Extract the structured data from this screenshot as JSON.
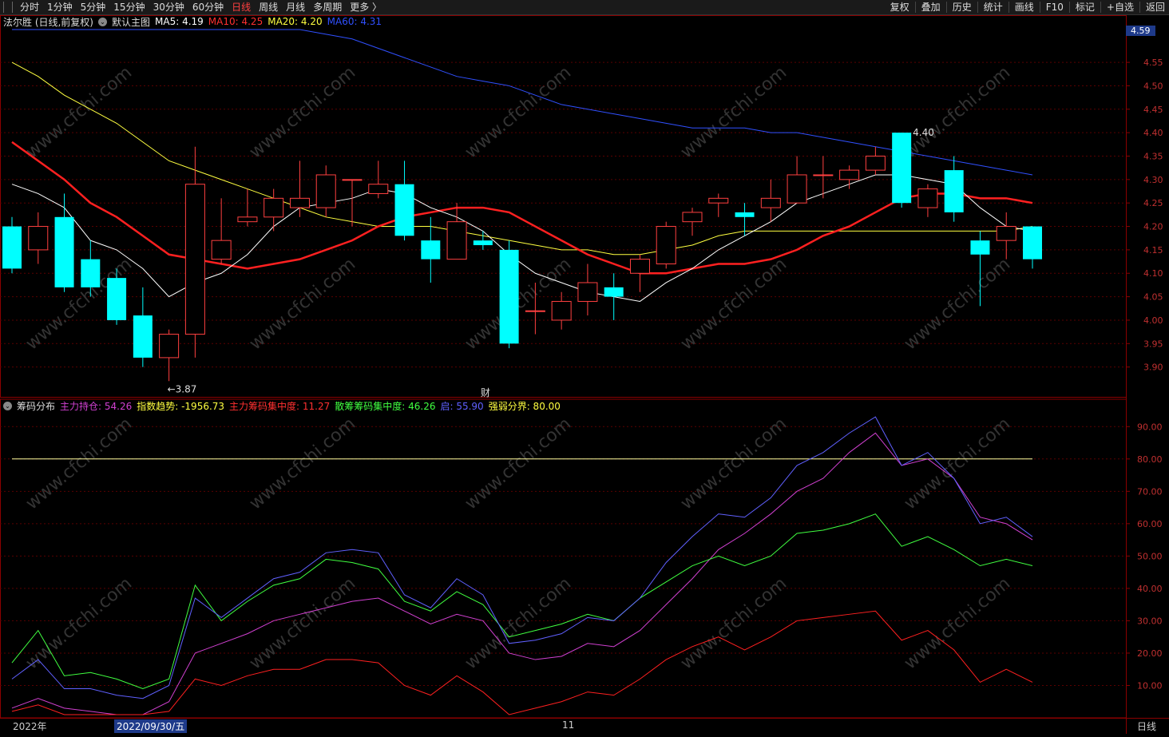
{
  "toolbar": {
    "left_items": [
      "分时",
      "1分钟",
      "5分钟",
      "15分钟",
      "30分钟",
      "60分钟",
      "日线",
      "周线",
      "月线",
      "多周期",
      "更多 〉"
    ],
    "active_item": "日线",
    "right_items": [
      "复权",
      "叠加",
      "历史",
      "统计",
      "画线",
      "F10",
      "标记",
      "+自选",
      "返回"
    ]
  },
  "main_legend": {
    "stock": "法尔胜 (日线,前复权)",
    "template": "默认主图",
    "ma5": "MA5: 4.19",
    "ma10": "MA10: 4.25",
    "ma20": "MA20: 4.20",
    "ma60": "MA60: 4.31",
    "colors": {
      "ma5": "#ffffff",
      "ma10": "#ff3030",
      "ma20": "#ffff40",
      "ma60": "#3050ff"
    }
  },
  "current_price_tag": "4.59",
  "price_axis": [
    "4.55",
    "4.50",
    "4.45",
    "4.40",
    "4.35",
    "4.30",
    "4.25",
    "4.20",
    "4.15",
    "4.10",
    "4.05",
    "4.00",
    "3.95",
    "3.90"
  ],
  "annotations": {
    "high": "4.40",
    "low": "←3.87",
    "marker": "财"
  },
  "sub_legend": {
    "name": "筹码分布",
    "main_hold": "主力持仓: 54.26",
    "index_trend": "指数趋势: -1956.73",
    "main_conc": "主力筹码集中度: 11.27",
    "retail_conc": "散筹筹码集中度: 46.26",
    "qi": "启: 55.90",
    "strong_weak": "强弱分界: 80.00"
  },
  "sub_axis": [
    "90.00",
    "80.00",
    "70.00",
    "60.00",
    "50.00",
    "40.00",
    "30.00",
    "20.00",
    "10.00"
  ],
  "bottom": {
    "year": "2022年",
    "date_tag": "2022/09/30/五",
    "month": "11",
    "period": "日线"
  },
  "watermark": "www.cfchi.com",
  "chart_data": {
    "type": "candlestick",
    "candles": [
      {
        "o": 4.2,
        "c": 4.11,
        "h": 4.22,
        "l": 4.1
      },
      {
        "o": 4.15,
        "c": 4.2,
        "h": 4.23,
        "l": 4.12
      },
      {
        "o": 4.22,
        "c": 4.07,
        "h": 4.27,
        "l": 4.06
      },
      {
        "o": 4.13,
        "c": 4.07,
        "h": 4.17,
        "l": 4.05
      },
      {
        "o": 4.09,
        "c": 4.0,
        "h": 4.11,
        "l": 3.99
      },
      {
        "o": 4.01,
        "c": 3.92,
        "h": 4.07,
        "l": 3.9
      },
      {
        "o": 3.92,
        "c": 3.97,
        "h": 3.98,
        "l": 3.87
      },
      {
        "o": 3.97,
        "c": 4.29,
        "h": 4.37,
        "l": 3.92
      },
      {
        "o": 4.13,
        "c": 4.17,
        "h": 4.26,
        "l": 4.12
      },
      {
        "o": 4.21,
        "c": 4.22,
        "h": 4.28,
        "l": 4.2
      },
      {
        "o": 4.22,
        "c": 4.26,
        "h": 4.28,
        "l": 4.19
      },
      {
        "o": 4.24,
        "c": 4.26,
        "h": 4.34,
        "l": 4.22
      },
      {
        "o": 4.24,
        "c": 4.31,
        "h": 4.33,
        "l": 4.22
      },
      {
        "o": 4.3,
        "c": 4.3,
        "h": 4.3,
        "l": 4.2
      },
      {
        "o": 4.27,
        "c": 4.29,
        "h": 4.34,
        "l": 4.26
      },
      {
        "o": 4.29,
        "c": 4.18,
        "h": 4.34,
        "l": 4.17
      },
      {
        "o": 4.17,
        "c": 4.13,
        "h": 4.22,
        "l": 4.08
      },
      {
        "o": 4.13,
        "c": 4.21,
        "h": 4.25,
        "l": 4.13
      },
      {
        "o": 4.17,
        "c": 4.16,
        "h": 4.19,
        "l": 4.15
      },
      {
        "o": 4.15,
        "c": 3.95,
        "h": 4.17,
        "l": 3.94
      },
      {
        "o": 4.02,
        "c": 4.02,
        "h": 4.08,
        "l": 3.97
      },
      {
        "o": 4.0,
        "c": 4.04,
        "h": 4.06,
        "l": 3.98
      },
      {
        "o": 4.04,
        "c": 4.08,
        "h": 4.12,
        "l": 4.01
      },
      {
        "o": 4.07,
        "c": 4.05,
        "h": 4.1,
        "l": 4.0
      },
      {
        "o": 4.1,
        "c": 4.13,
        "h": 4.14,
        "l": 4.06
      },
      {
        "o": 4.12,
        "c": 4.2,
        "h": 4.21,
        "l": 4.11
      },
      {
        "o": 4.21,
        "c": 4.23,
        "h": 4.24,
        "l": 4.18
      },
      {
        "o": 4.25,
        "c": 4.26,
        "h": 4.27,
        "l": 4.22
      },
      {
        "o": 4.23,
        "c": 4.22,
        "h": 4.25,
        "l": 4.18
      },
      {
        "o": 4.24,
        "c": 4.26,
        "h": 4.3,
        "l": 4.21
      },
      {
        "o": 4.25,
        "c": 4.31,
        "h": 4.35,
        "l": 4.25
      },
      {
        "o": 4.31,
        "c": 4.31,
        "h": 4.35,
        "l": 4.26
      },
      {
        "o": 4.3,
        "c": 4.32,
        "h": 4.33,
        "l": 4.28
      },
      {
        "o": 4.32,
        "c": 4.35,
        "h": 4.37,
        "l": 4.31
      },
      {
        "o": 4.4,
        "c": 4.25,
        "h": 4.4,
        "l": 4.24
      },
      {
        "o": 4.24,
        "c": 4.28,
        "h": 4.29,
        "l": 4.22
      },
      {
        "o": 4.32,
        "c": 4.23,
        "h": 4.35,
        "l": 4.21
      },
      {
        "o": 4.17,
        "c": 4.14,
        "h": 4.19,
        "l": 4.03
      },
      {
        "o": 4.17,
        "c": 4.2,
        "h": 4.23,
        "l": 4.13
      },
      {
        "o": 4.2,
        "c": 4.13,
        "h": 4.2,
        "l": 4.11
      }
    ],
    "ma5": [
      4.29,
      4.27,
      4.24,
      4.17,
      4.15,
      4.11,
      4.05,
      4.08,
      4.1,
      4.14,
      4.2,
      4.24,
      4.25,
      4.26,
      4.28,
      4.27,
      4.24,
      4.22,
      4.19,
      4.14,
      4.1,
      4.08,
      4.06,
      4.05,
      4.04,
      4.08,
      4.11,
      4.15,
      4.18,
      4.21,
      4.25,
      4.27,
      4.29,
      4.31,
      4.31,
      4.3,
      4.29,
      4.24,
      4.2,
      4.19
    ],
    "ma10": [
      4.38,
      4.34,
      4.3,
      4.25,
      4.22,
      4.18,
      4.14,
      4.13,
      4.12,
      4.11,
      4.12,
      4.13,
      4.15,
      4.17,
      4.2,
      4.22,
      4.23,
      4.24,
      4.24,
      4.23,
      4.2,
      4.17,
      4.14,
      4.12,
      4.1,
      4.1,
      4.11,
      4.12,
      4.12,
      4.13,
      4.15,
      4.18,
      4.2,
      4.23,
      4.26,
      4.27,
      4.27,
      4.26,
      4.26,
      4.25
    ],
    "ma20": [
      4.55,
      4.52,
      4.48,
      4.45,
      4.42,
      4.38,
      4.34,
      4.32,
      4.3,
      4.28,
      4.26,
      4.24,
      4.22,
      4.21,
      4.2,
      4.2,
      4.2,
      4.19,
      4.18,
      4.17,
      4.16,
      4.15,
      4.15,
      4.14,
      4.14,
      4.15,
      4.16,
      4.18,
      4.19,
      4.19,
      4.19,
      4.19,
      4.19,
      4.19,
      4.19,
      4.19,
      4.19,
      4.19,
      4.19,
      4.2
    ],
    "ma60": [
      4.62,
      4.62,
      4.62,
      4.62,
      4.62,
      4.62,
      4.62,
      4.62,
      4.62,
      4.62,
      4.62,
      4.62,
      4.61,
      4.6,
      4.58,
      4.56,
      4.54,
      4.52,
      4.51,
      4.5,
      4.48,
      4.46,
      4.45,
      4.44,
      4.43,
      4.42,
      4.41,
      4.41,
      4.41,
      4.4,
      4.4,
      4.39,
      4.38,
      4.37,
      4.36,
      4.35,
      4.34,
      4.33,
      4.32,
      4.31
    ],
    "sub_series": [
      {
        "name": "主力持仓",
        "color": "#d040d0",
        "values": [
          3,
          6,
          3,
          2,
          1,
          1,
          5,
          20,
          23,
          26,
          30,
          32,
          34,
          36,
          37,
          33,
          29,
          32,
          30,
          20,
          18,
          19,
          23,
          22,
          27,
          35,
          43,
          52,
          57,
          63,
          70,
          74,
          82,
          88,
          78,
          80,
          74,
          62,
          60,
          55
        ]
      },
      {
        "name": "散筹筹码集中度",
        "color": "#40ff40",
        "values": [
          17,
          27,
          13,
          14,
          12,
          9,
          12,
          41,
          30,
          36,
          41,
          43,
          49,
          48,
          46,
          36,
          33,
          39,
          35,
          25,
          27,
          29,
          32,
          30,
          37,
          42,
          47,
          50,
          47,
          50,
          57,
          58,
          60,
          63,
          53,
          56,
          52,
          47,
          49,
          47
        ]
      },
      {
        "name": "主力筹码集中度",
        "color": "#ff2020",
        "values": [
          2,
          4,
          1,
          1,
          1,
          1,
          2,
          12,
          10,
          13,
          15,
          15,
          18,
          18,
          17,
          10,
          7,
          13,
          8,
          1,
          3,
          5,
          8,
          7,
          12,
          18,
          22,
          25,
          21,
          25,
          30,
          31,
          32,
          33,
          24,
          27,
          21,
          11,
          15,
          11
        ]
      },
      {
        "name": "启",
        "color": "#6060ff",
        "values": [
          12,
          18,
          9,
          9,
          7,
          6,
          10,
          37,
          31,
          37,
          43,
          45,
          51,
          52,
          51,
          38,
          34,
          43,
          38,
          23,
          24,
          26,
          31,
          30,
          37,
          48,
          56,
          63,
          62,
          68,
          78,
          82,
          88,
          93,
          78,
          82,
          74,
          60,
          62,
          56
        ]
      }
    ],
    "strong_weak_line": 80,
    "y_range_main": [
      3.85,
      4.62
    ],
    "y_range_sub": [
      0,
      95
    ]
  }
}
